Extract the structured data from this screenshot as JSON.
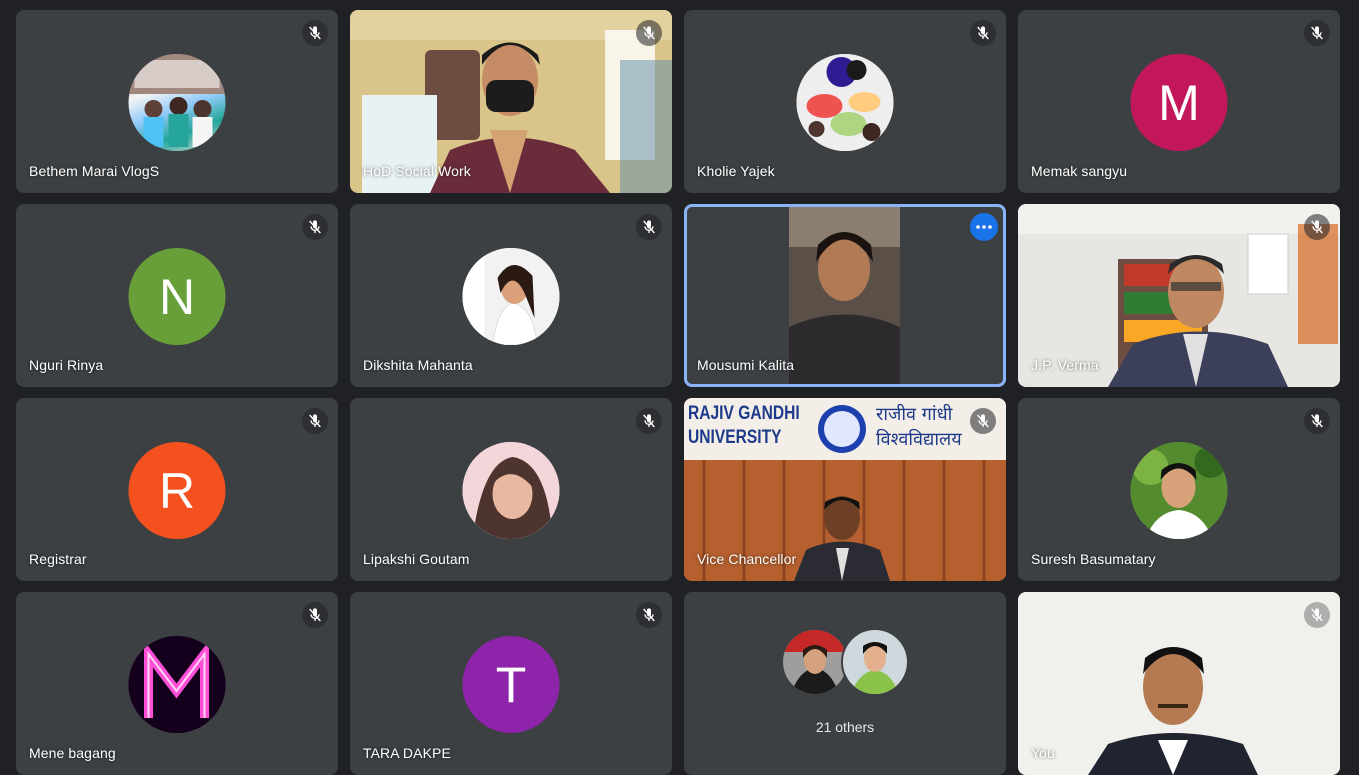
{
  "participants": [
    {
      "name": "Bethem Marai VlogS",
      "kind": "avatar-photo",
      "muted": true
    },
    {
      "name": "HoD Social Work",
      "kind": "video",
      "muted": true
    },
    {
      "name": "Kholie Yajek",
      "kind": "avatar-photo",
      "muted": true
    },
    {
      "name": "Memak sangyu",
      "kind": "initial",
      "initial": "M",
      "color": "#c2185b",
      "muted": true
    },
    {
      "name": "Nguri Rinya",
      "kind": "initial",
      "initial": "N",
      "color": "#689f38",
      "muted": true
    },
    {
      "name": "Dikshita Mahanta",
      "kind": "avatar-photo",
      "muted": true
    },
    {
      "name": "Mousumi Kalita",
      "kind": "video",
      "muted": false,
      "active": true
    },
    {
      "name": "J.P. Verma",
      "kind": "video",
      "muted": true
    },
    {
      "name": "Registrar",
      "kind": "initial",
      "initial": "R",
      "color": "#f4511e",
      "muted": true
    },
    {
      "name": "Lipakshi Goutam",
      "kind": "avatar-photo",
      "muted": true
    },
    {
      "name": "Vice Chancellor",
      "kind": "video",
      "muted": true
    },
    {
      "name": "Suresh Basumatary",
      "kind": "avatar-photo",
      "muted": true
    },
    {
      "name": "Mene bagang",
      "kind": "avatar-photo",
      "muted": true
    },
    {
      "name": "TARA DAKPE",
      "kind": "initial",
      "initial": "T",
      "color": "#8e24aa",
      "muted": true
    },
    {
      "name": "",
      "kind": "others",
      "muted": false
    },
    {
      "name": "You",
      "kind": "video",
      "muted": true
    }
  ],
  "others": {
    "label": "21 others"
  },
  "banner": {
    "line1_en": "RAJIV GANDHI",
    "line2_en": "UNIVERSITY",
    "line1_hi": "राजीव गांधी",
    "line2_hi": "विश्वविद्यालय"
  },
  "icons": {
    "mic": "mic-off-icon",
    "more": "more-options-icon"
  },
  "colors": {
    "background": "#202124",
    "tile": "#3c4043",
    "active_border": "#8ab4f8",
    "accent": "#1a73e8"
  }
}
